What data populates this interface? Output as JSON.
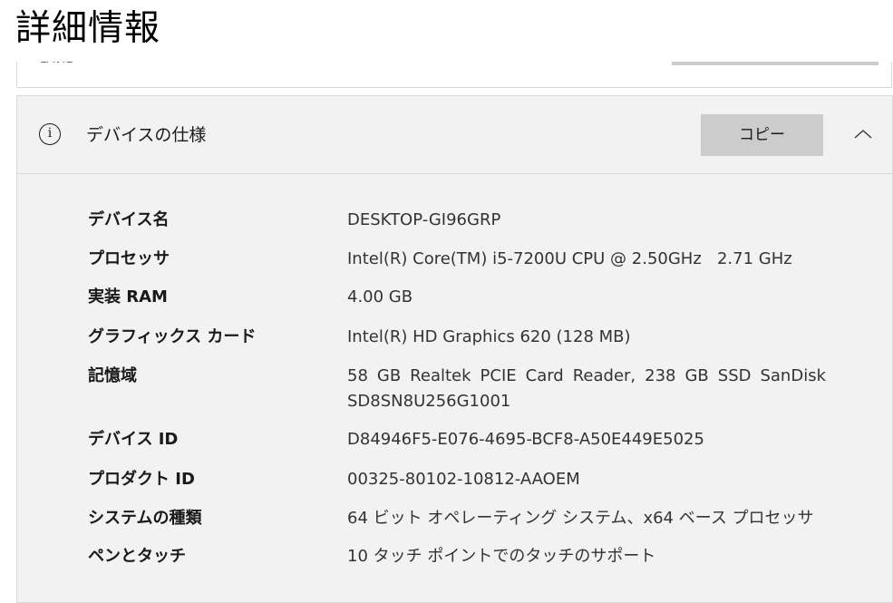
{
  "page": {
    "title": "詳細情報"
  },
  "previous_card": {
    "cut_text": "LAVIE"
  },
  "device_specs": {
    "icon": "info-icon",
    "title": "デバイスの仕様",
    "copy_label": "コピー",
    "collapse_icon": "chevron-up-icon",
    "rows": [
      {
        "label": "デバイス名",
        "value": "DESKTOP-GI96GRP"
      },
      {
        "label": "プロセッサ",
        "value": "Intel(R) Core(TM) i5-7200U CPU @ 2.50GHz   2.71 GHz"
      },
      {
        "label": "実装 RAM",
        "value": "4.00 GB"
      },
      {
        "label": "グラフィックス カード",
        "value": "Intel(R) HD Graphics 620 (128 MB)"
      },
      {
        "label": "記憶域",
        "value": "58 GB Realtek PCIE Card Reader, 238 GB SSD SanDisk SD8SN8U256G1001"
      },
      {
        "label": "デバイス ID",
        "value": "D84946F5-E076-4695-BCF8-A50E449E5025"
      },
      {
        "label": "プロダクト ID",
        "value": "00325-80102-10812-AAOEM"
      },
      {
        "label": "システムの種類",
        "value": "64 ビット オペレーティング システム、x64 ベース プロセッサ"
      },
      {
        "label": "ペンとタッチ",
        "value": "10 タッチ ポイントでのタッチのサポート"
      }
    ]
  },
  "colors": {
    "card_background": "#f2f2f2",
    "button_background": "#cccccc",
    "border": "#d9d9d9"
  }
}
